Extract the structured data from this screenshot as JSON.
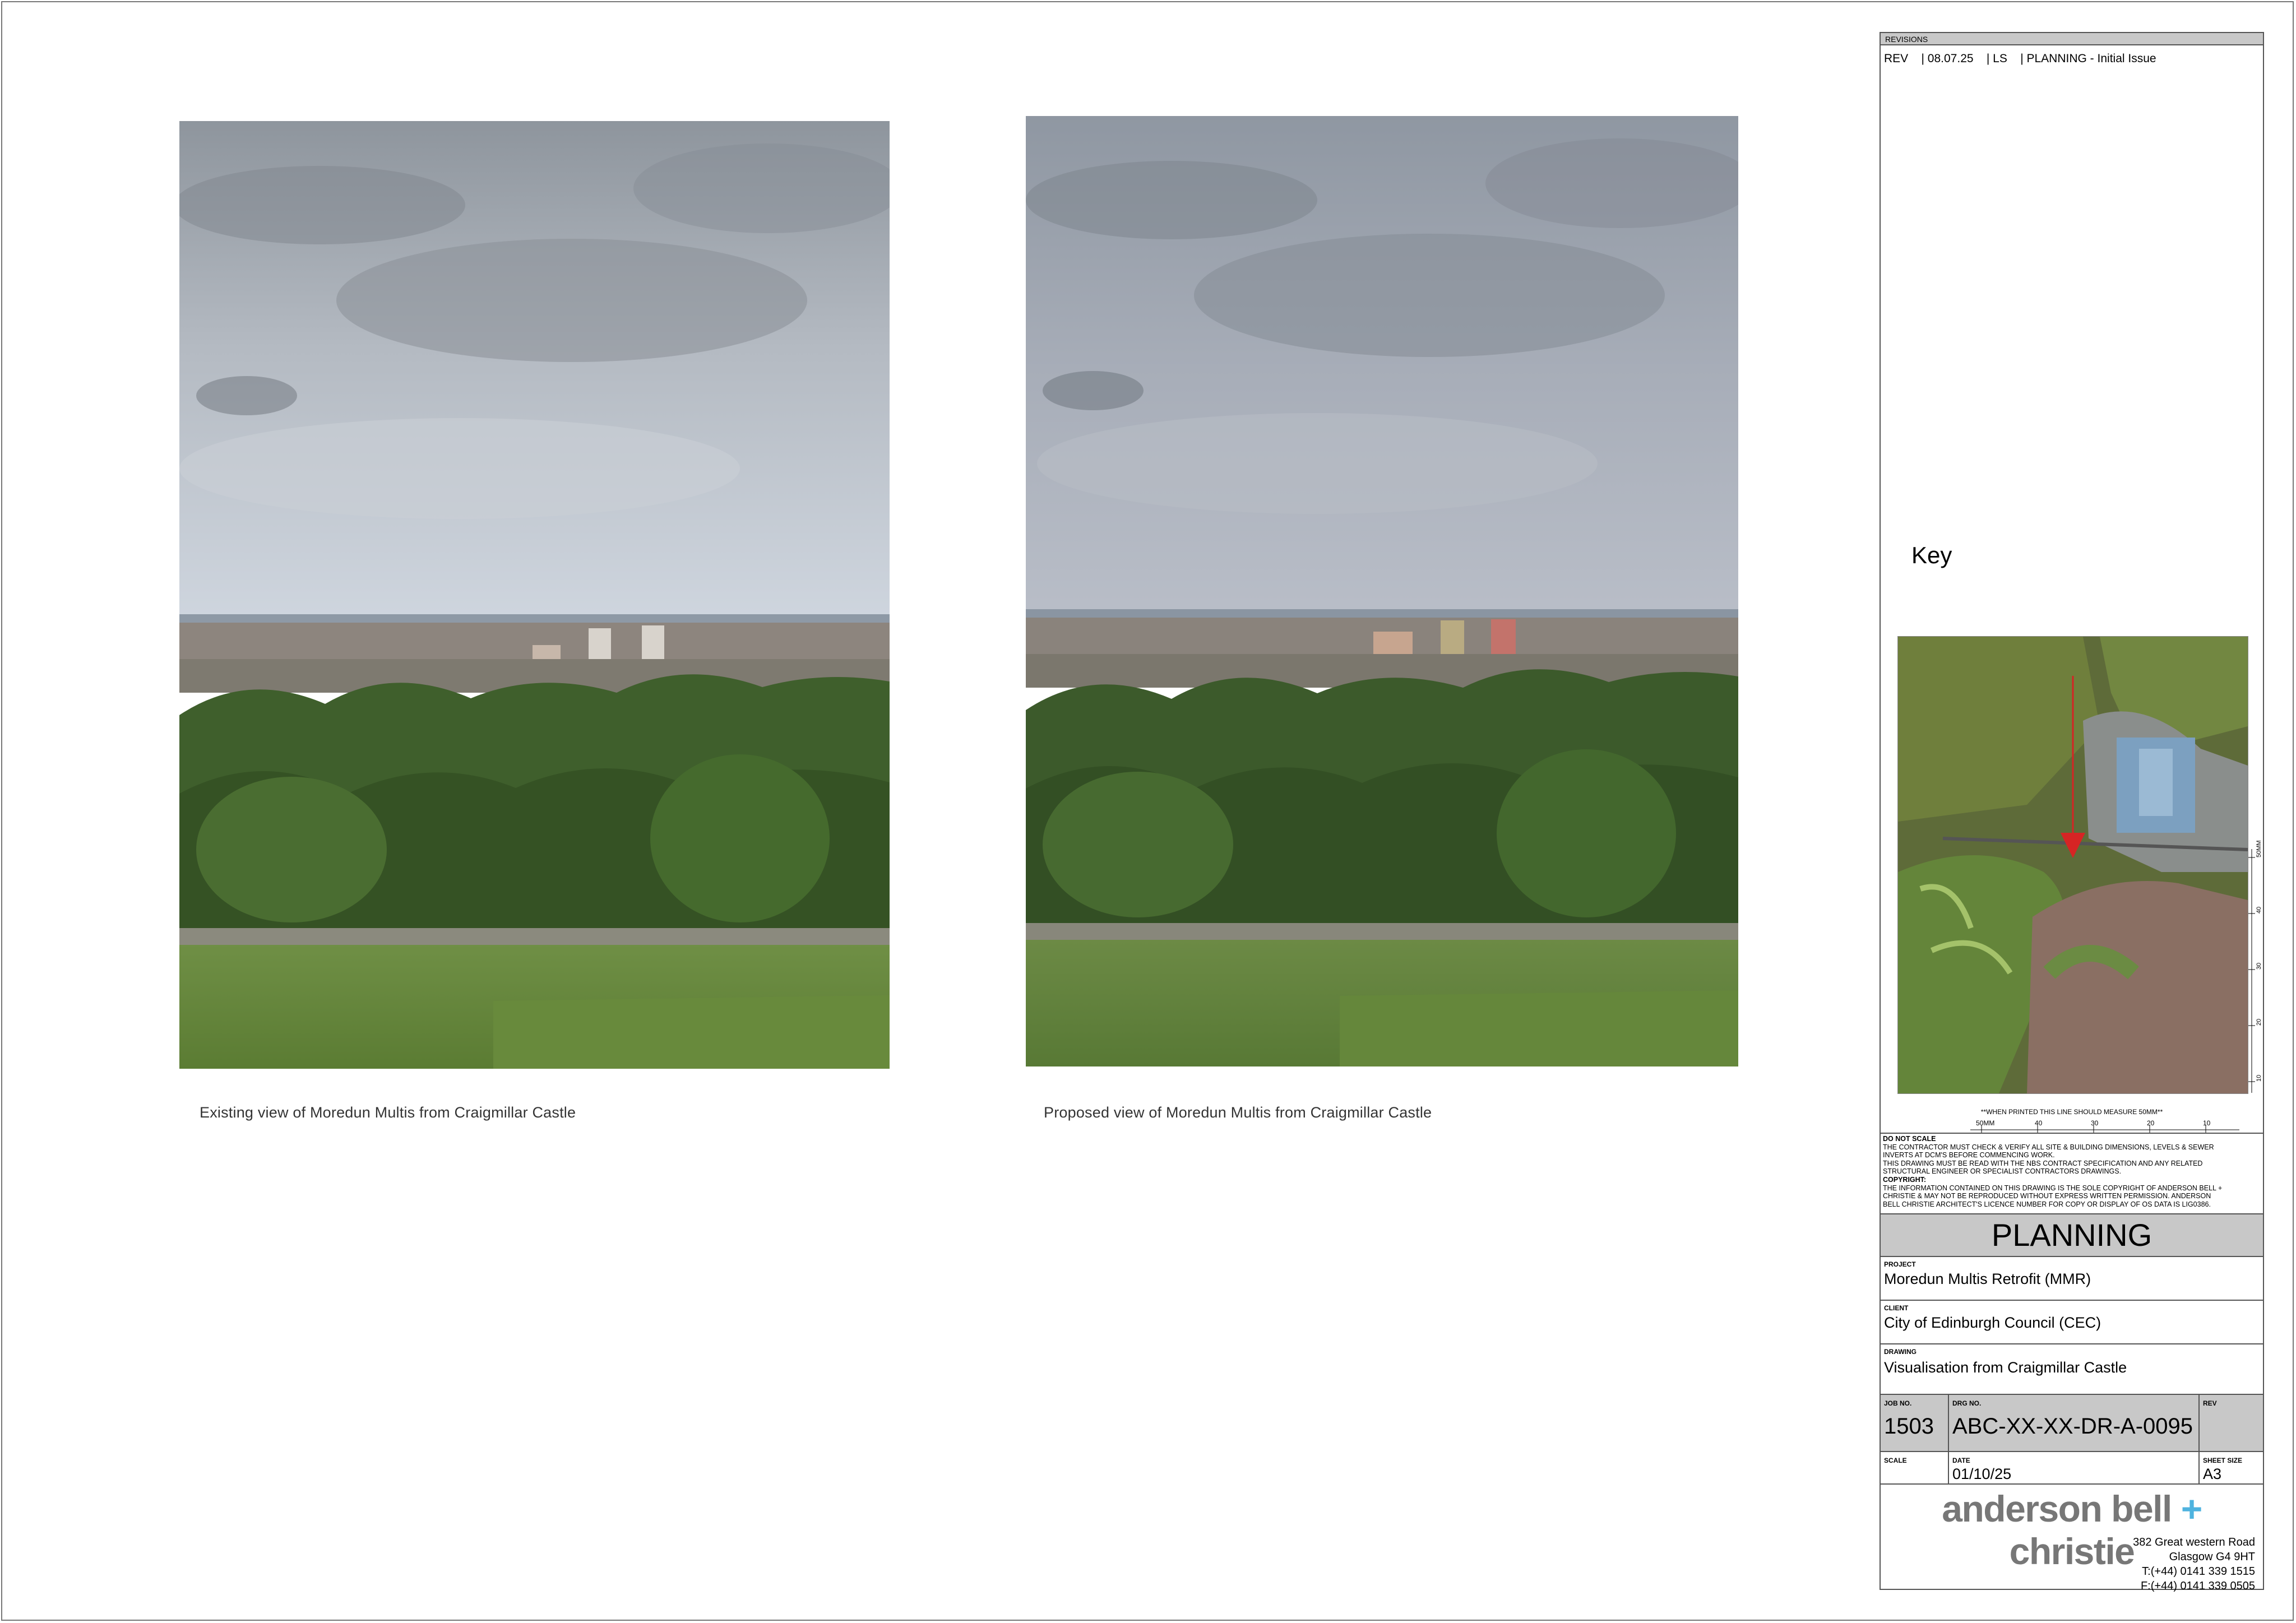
{
  "photos": {
    "existing_caption": "Existing view of Moredun Multis from Craigmillar Castle",
    "proposed_caption": "Proposed view of Moredun Multis from Craigmillar Castle"
  },
  "title_block": {
    "revisions_header": "REVISIONS",
    "revision_row": "REV    | 08.07.25    | LS    | PLANNING - Initial Issue",
    "key_label": "Key",
    "print_note": "**WHEN PRINTED THIS LINE SHOULD MEASURE 50MM**",
    "scale_labels": [
      "50MM",
      "40",
      "30",
      "20",
      "10"
    ],
    "side_scale_labels": [
      "50MM",
      "40",
      "30",
      "20",
      "10"
    ],
    "notes": {
      "do_not_scale": "DO NOT SCALE",
      "contractor_line_1": "THE CONTRACTOR MUST CHECK & VERIFY ALL SITE & BUILDING DIMENSIONS, LEVELS & SEWER",
      "contractor_line_2": "INVERTS AT DCM'S BEFORE COMMENCING WORK.",
      "nbs_line_1": "THIS DRAWING MUST BE READ WITH THE NBS CONTRACT SPECIFICATION AND ANY RELATED",
      "nbs_line_2": "STRUCTURAL ENGINEER OR SPECIALIST CONTRACTORS DRAWINGS.",
      "copyright": "COPYRIGHT:",
      "copyright_line_1": "THE INFORMATION CONTAINED ON THIS DRAWING IS THE SOLE COPYRIGHT OF ANDERSON BELL +",
      "copyright_line_2": "CHRISTIE & MAY NOT BE REPRODUCED WITHOUT EXPRESS WRITTEN PERMISSION. ANDERSON",
      "copyright_line_3": "BELL CHRISTIE ARCHITECT'S LICENCE NUMBER FOR COPY OR DISPLAY OF OS DATA IS LIG0386."
    },
    "status": "PLANNING",
    "project_label": "PROJECT",
    "project": "Moredun Multis Retrofit (MMR)",
    "client_label": "CLIENT",
    "client": "City of Edinburgh Council (CEC)",
    "drawing_label": "DRAWING",
    "drawing": "Visualisation from Craigmillar Castle",
    "job_no_label": "JOB NO.",
    "job_no": "1503",
    "drg_no_label": "DRG NO.",
    "drg_no": "ABC-XX-XX-DR-A-0095",
    "rev_label": "REV",
    "rev": "",
    "scale_label": "SCALE",
    "scale": "",
    "date_label": "DATE",
    "date": "01/10/25",
    "sheet_size_label": "SHEET SIZE",
    "sheet_size": "A3",
    "logo": {
      "part1": "anderson bell ",
      "plus": "+",
      "part2": " christie"
    },
    "address": {
      "line1": "382 Great western Road",
      "line2": "Glasgow G4 9HT",
      "tel": "T:(+44) 0141 339 1515",
      "fax": "F:(+44) 0141 339 0505"
    }
  }
}
